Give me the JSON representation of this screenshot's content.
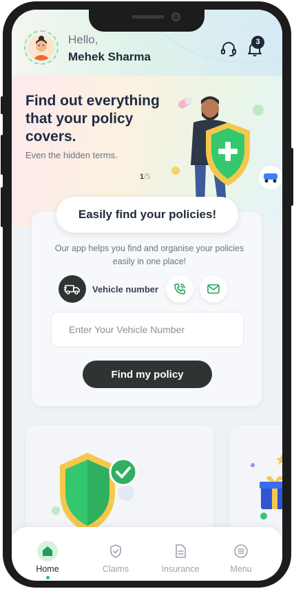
{
  "header": {
    "greeting": "Hello,",
    "user_name": "Mehek Sharma",
    "notification_count": "3",
    "support_icon": "headset-icon",
    "notification_icon": "bell-icon"
  },
  "banner": {
    "title": "Find out everything that your policy covers.",
    "subtitle": "Even the hidden terms.",
    "page_current": "1",
    "page_total": "/5"
  },
  "find_policy": {
    "heading": "Easily find your policies!",
    "description": "Our app helps you find and organise your policies easily in one place!",
    "options": [
      {
        "label": "Vehicle number",
        "icon": "truck-icon",
        "selected": true
      },
      {
        "label": "",
        "icon": "phone-icon",
        "selected": false
      },
      {
        "label": "",
        "icon": "mail-icon",
        "selected": false
      }
    ],
    "input_placeholder": "Enter Your Vehicle Number",
    "input_value": "",
    "button_label": "Find my policy"
  },
  "bottom_nav": {
    "items": [
      {
        "label": "Home",
        "icon": "home-icon",
        "active": true
      },
      {
        "label": "Claims",
        "icon": "shield-check-icon",
        "active": false
      },
      {
        "label": "Insurance",
        "icon": "document-icon",
        "active": false
      },
      {
        "label": "Menu",
        "icon": "menu-icon",
        "active": false
      }
    ]
  },
  "colors": {
    "primary_dark": "#2f3432",
    "accent_green": "#22c55e",
    "shield_yellow": "#f5c84b",
    "text_dark": "#1f2a44"
  }
}
